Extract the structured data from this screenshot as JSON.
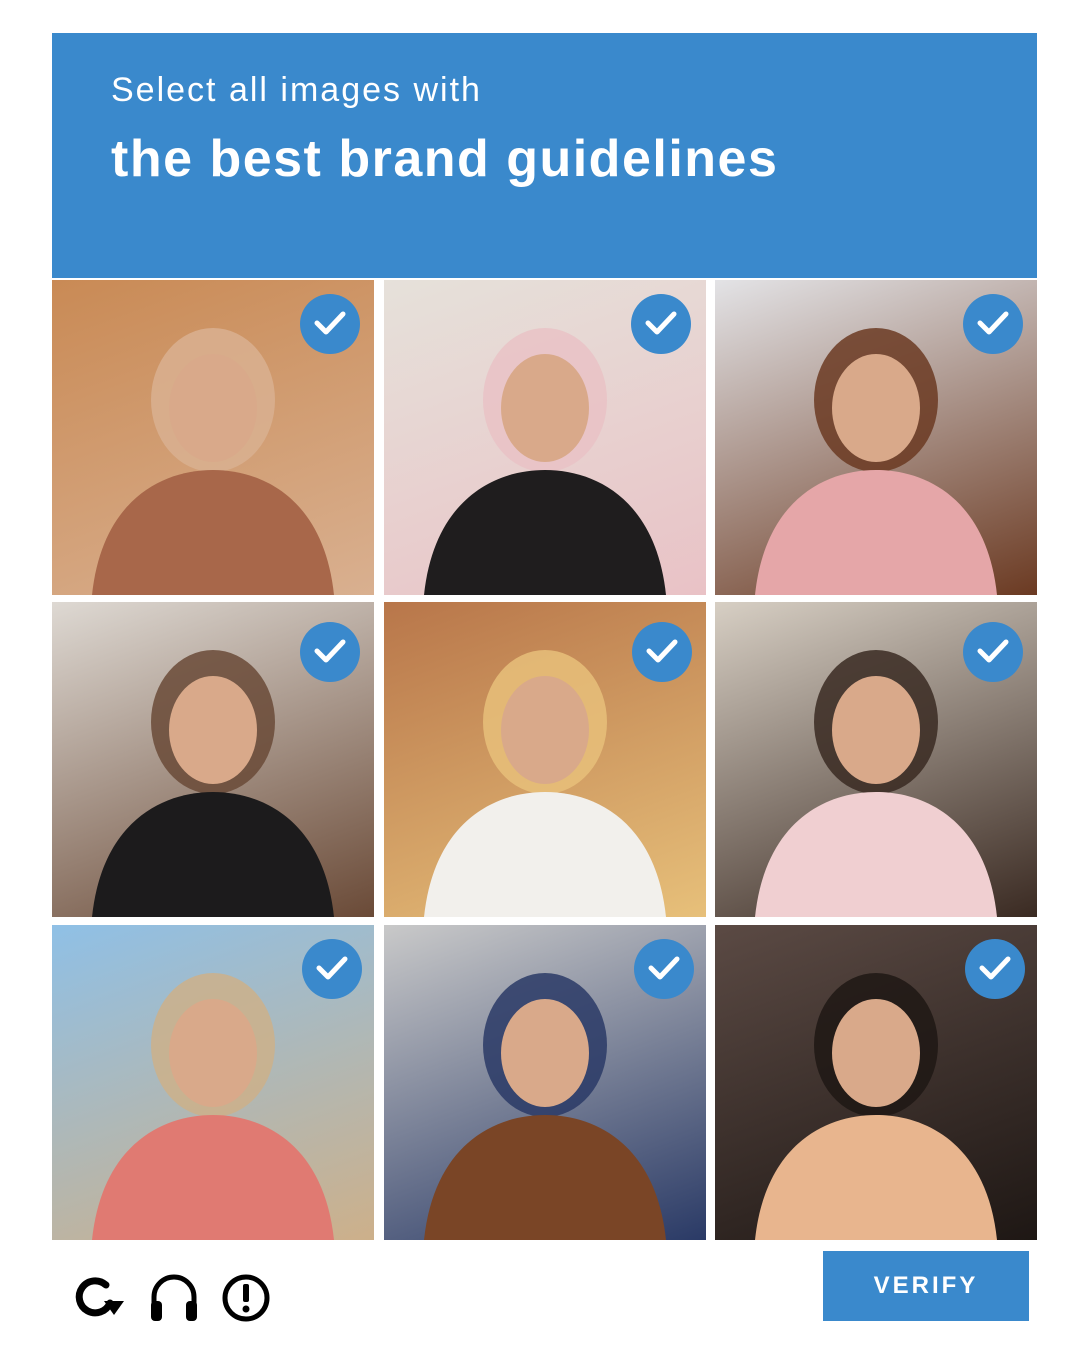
{
  "header": {
    "prompt": "Select all images with",
    "target": "the best brand guidelines",
    "background_color": "#3a89cc"
  },
  "tiles": [
    {
      "selected": true,
      "bg": "#c98a55",
      "fg": "#a8674a",
      "accent": "#d9b090"
    },
    {
      "selected": true,
      "bg": "#e6e1da",
      "fg": "#1f1d1e",
      "accent": "#e9c2c6"
    },
    {
      "selected": true,
      "bg": "#e3e3e6",
      "fg": "#e5a6a8",
      "accent": "#6b3a22"
    },
    {
      "selected": true,
      "bg": "#ded9d3",
      "fg": "#1c1b1c",
      "accent": "#6a4a37"
    },
    {
      "selected": true,
      "bg": "#b8764a",
      "fg": "#f2f0ec",
      "accent": "#e7c07a"
    },
    {
      "selected": true,
      "bg": "#d7cfc4",
      "fg": "#f0cfd1",
      "accent": "#3a2a22"
    },
    {
      "selected": true,
      "bg": "#8fc0e6",
      "fg": "#e07a72",
      "accent": "#cdb08a"
    },
    {
      "selected": true,
      "bg": "#c9c9c9",
      "fg": "#7a4526",
      "accent": "#2a3a66"
    },
    {
      "selected": true,
      "bg": "#5b4a44",
      "fg": "#e8b58e",
      "accent": "#1e1714"
    }
  ],
  "check_icon": "checkmark-icon",
  "footer": {
    "icons": [
      "reload-icon",
      "headphones-icon",
      "alert-icon"
    ],
    "verify_label": "VERIFY"
  }
}
